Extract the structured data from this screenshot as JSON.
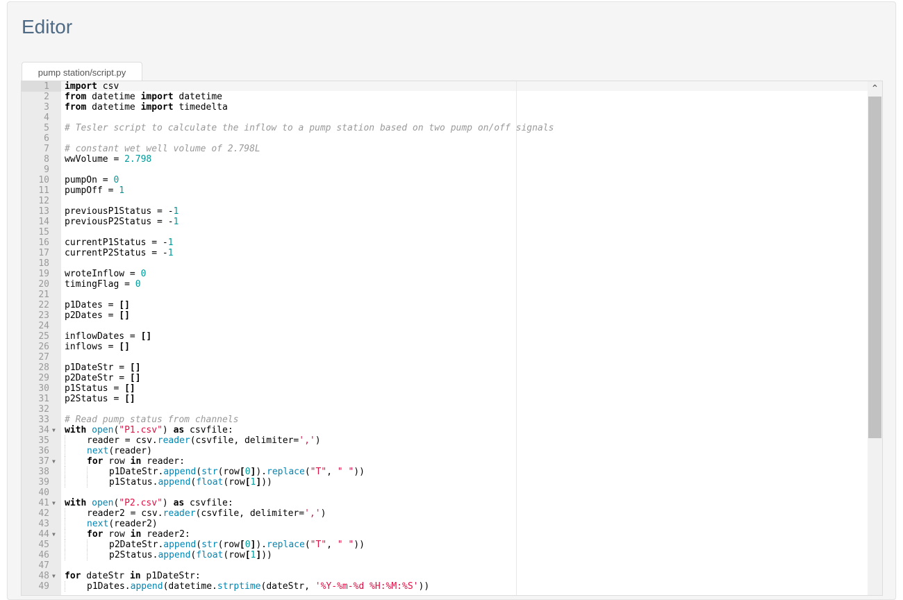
{
  "page": {
    "title": "Editor"
  },
  "tab": {
    "label": "pump station/script.py"
  },
  "scrollbar": {
    "up_icon": "chevron-up-icon"
  },
  "lines": [
    {
      "n": "1",
      "fold": false,
      "indent": 0,
      "tokens": [
        [
          "k",
          "import"
        ],
        [
          "t",
          " csv"
        ]
      ]
    },
    {
      "n": "2",
      "fold": false,
      "indent": 0,
      "tokens": [
        [
          "k",
          "from"
        ],
        [
          "t",
          " datetime "
        ],
        [
          "k",
          "import"
        ],
        [
          "t",
          " datetime"
        ]
      ]
    },
    {
      "n": "3",
      "fold": false,
      "indent": 0,
      "tokens": [
        [
          "k",
          "from"
        ],
        [
          "t",
          " datetime "
        ],
        [
          "k",
          "import"
        ],
        [
          "t",
          " timedelta"
        ]
      ]
    },
    {
      "n": "4",
      "fold": false,
      "indent": 0,
      "tokens": []
    },
    {
      "n": "5",
      "fold": false,
      "indent": 0,
      "tokens": [
        [
          "c",
          "# Tesler script to calculate the inflow to a pump station based on two pump on/off signals"
        ]
      ]
    },
    {
      "n": "6",
      "fold": false,
      "indent": 0,
      "tokens": []
    },
    {
      "n": "7",
      "fold": false,
      "indent": 0,
      "tokens": [
        [
          "c",
          "# constant wet well volume of 2.798L"
        ]
      ]
    },
    {
      "n": "8",
      "fold": false,
      "indent": 0,
      "tokens": [
        [
          "t",
          "wwVolume = "
        ],
        [
          "n",
          "2.798"
        ]
      ]
    },
    {
      "n": "9",
      "fold": false,
      "indent": 0,
      "tokens": []
    },
    {
      "n": "10",
      "fold": false,
      "indent": 0,
      "tokens": [
        [
          "t",
          "pumpOn = "
        ],
        [
          "n",
          "0"
        ]
      ]
    },
    {
      "n": "11",
      "fold": false,
      "indent": 0,
      "tokens": [
        [
          "t",
          "pumpOff = "
        ],
        [
          "n",
          "1"
        ]
      ]
    },
    {
      "n": "12",
      "fold": false,
      "indent": 0,
      "tokens": []
    },
    {
      "n": "13",
      "fold": false,
      "indent": 0,
      "tokens": [
        [
          "t",
          "previousP1Status = -"
        ],
        [
          "n",
          "1"
        ]
      ]
    },
    {
      "n": "14",
      "fold": false,
      "indent": 0,
      "tokens": [
        [
          "t",
          "previousP2Status = -"
        ],
        [
          "n",
          "1"
        ]
      ]
    },
    {
      "n": "15",
      "fold": false,
      "indent": 0,
      "tokens": []
    },
    {
      "n": "16",
      "fold": false,
      "indent": 0,
      "tokens": [
        [
          "t",
          "currentP1Status = -"
        ],
        [
          "n",
          "1"
        ]
      ]
    },
    {
      "n": "17",
      "fold": false,
      "indent": 0,
      "tokens": [
        [
          "t",
          "currentP2Status = -"
        ],
        [
          "n",
          "1"
        ]
      ]
    },
    {
      "n": "18",
      "fold": false,
      "indent": 0,
      "tokens": []
    },
    {
      "n": "19",
      "fold": false,
      "indent": 0,
      "tokens": [
        [
          "t",
          "wroteInflow = "
        ],
        [
          "n",
          "0"
        ]
      ]
    },
    {
      "n": "20",
      "fold": false,
      "indent": 0,
      "tokens": [
        [
          "t",
          "timingFlag = "
        ],
        [
          "n",
          "0"
        ]
      ]
    },
    {
      "n": "21",
      "fold": false,
      "indent": 0,
      "tokens": []
    },
    {
      "n": "22",
      "fold": false,
      "indent": 0,
      "tokens": [
        [
          "t",
          "p1Dates = "
        ],
        [
          "b",
          "[]"
        ]
      ]
    },
    {
      "n": "23",
      "fold": false,
      "indent": 0,
      "tokens": [
        [
          "t",
          "p2Dates = "
        ],
        [
          "b",
          "[]"
        ]
      ]
    },
    {
      "n": "24",
      "fold": false,
      "indent": 0,
      "tokens": []
    },
    {
      "n": "25",
      "fold": false,
      "indent": 0,
      "tokens": [
        [
          "t",
          "inflowDates = "
        ],
        [
          "b",
          "[]"
        ]
      ]
    },
    {
      "n": "26",
      "fold": false,
      "indent": 0,
      "tokens": [
        [
          "t",
          "inflows = "
        ],
        [
          "b",
          "[]"
        ]
      ]
    },
    {
      "n": "27",
      "fold": false,
      "indent": 0,
      "tokens": []
    },
    {
      "n": "28",
      "fold": false,
      "indent": 0,
      "tokens": [
        [
          "t",
          "p1DateStr = "
        ],
        [
          "b",
          "[]"
        ]
      ]
    },
    {
      "n": "29",
      "fold": false,
      "indent": 0,
      "tokens": [
        [
          "t",
          "p2DateStr = "
        ],
        [
          "b",
          "[]"
        ]
      ]
    },
    {
      "n": "30",
      "fold": false,
      "indent": 0,
      "tokens": [
        [
          "t",
          "p1Status = "
        ],
        [
          "b",
          "[]"
        ]
      ]
    },
    {
      "n": "31",
      "fold": false,
      "indent": 0,
      "tokens": [
        [
          "t",
          "p2Status = "
        ],
        [
          "b",
          "[]"
        ]
      ]
    },
    {
      "n": "32",
      "fold": false,
      "indent": 0,
      "tokens": []
    },
    {
      "n": "33",
      "fold": false,
      "indent": 0,
      "tokens": [
        [
          "c",
          "# Read pump status from channels"
        ]
      ]
    },
    {
      "n": "34",
      "fold": true,
      "indent": 0,
      "tokens": [
        [
          "k",
          "with"
        ],
        [
          "t",
          " "
        ],
        [
          "f",
          "open"
        ],
        [
          "t",
          "("
        ],
        [
          "s",
          "\"P1.csv\""
        ],
        [
          "t",
          ") "
        ],
        [
          "k",
          "as"
        ],
        [
          "t",
          " csvfile:"
        ]
      ]
    },
    {
      "n": "35",
      "fold": false,
      "indent": 1,
      "tokens": [
        [
          "t",
          "reader = csv."
        ],
        [
          "f",
          "reader"
        ],
        [
          "t",
          "(csvfile, delimiter="
        ],
        [
          "s",
          "','"
        ],
        [
          "t",
          ")"
        ]
      ]
    },
    {
      "n": "36",
      "fold": false,
      "indent": 1,
      "tokens": [
        [
          "f",
          "next"
        ],
        [
          "t",
          "(reader)"
        ]
      ]
    },
    {
      "n": "37",
      "fold": true,
      "indent": 1,
      "tokens": [
        [
          "k",
          "for"
        ],
        [
          "t",
          " row "
        ],
        [
          "k",
          "in"
        ],
        [
          "t",
          " reader:"
        ]
      ]
    },
    {
      "n": "38",
      "fold": false,
      "indent": 2,
      "tokens": [
        [
          "t",
          "p1DateStr."
        ],
        [
          "f",
          "append"
        ],
        [
          "t",
          "("
        ],
        [
          "f",
          "str"
        ],
        [
          "t",
          "(row"
        ],
        [
          "b",
          "["
        ],
        [
          "n",
          "0"
        ],
        [
          "b",
          "]"
        ],
        [
          "t",
          ")."
        ],
        [
          "f",
          "replace"
        ],
        [
          "t",
          "("
        ],
        [
          "s",
          "\"T\""
        ],
        [
          "t",
          ", "
        ],
        [
          "s",
          "\" \""
        ],
        [
          "t",
          "))"
        ]
      ]
    },
    {
      "n": "39",
      "fold": false,
      "indent": 2,
      "tokens": [
        [
          "t",
          "p1Status."
        ],
        [
          "f",
          "append"
        ],
        [
          "t",
          "("
        ],
        [
          "f",
          "float"
        ],
        [
          "t",
          "(row"
        ],
        [
          "b",
          "["
        ],
        [
          "n",
          "1"
        ],
        [
          "b",
          "]"
        ],
        [
          "t",
          "))"
        ]
      ]
    },
    {
      "n": "40",
      "fold": false,
      "indent": 0,
      "tokens": []
    },
    {
      "n": "41",
      "fold": true,
      "indent": 0,
      "tokens": [
        [
          "k",
          "with"
        ],
        [
          "t",
          " "
        ],
        [
          "f",
          "open"
        ],
        [
          "t",
          "("
        ],
        [
          "s",
          "\"P2.csv\""
        ],
        [
          "t",
          ") "
        ],
        [
          "k",
          "as"
        ],
        [
          "t",
          " csvfile:"
        ]
      ]
    },
    {
      "n": "42",
      "fold": false,
      "indent": 1,
      "tokens": [
        [
          "t",
          "reader2 = csv."
        ],
        [
          "f",
          "reader"
        ],
        [
          "t",
          "(csvfile, delimiter="
        ],
        [
          "s",
          "','"
        ],
        [
          "t",
          ")"
        ]
      ]
    },
    {
      "n": "43",
      "fold": false,
      "indent": 1,
      "tokens": [
        [
          "f",
          "next"
        ],
        [
          "t",
          "(reader2)"
        ]
      ]
    },
    {
      "n": "44",
      "fold": true,
      "indent": 1,
      "tokens": [
        [
          "k",
          "for"
        ],
        [
          "t",
          " row "
        ],
        [
          "k",
          "in"
        ],
        [
          "t",
          " reader2:"
        ]
      ]
    },
    {
      "n": "45",
      "fold": false,
      "indent": 2,
      "tokens": [
        [
          "t",
          "p2DateStr."
        ],
        [
          "f",
          "append"
        ],
        [
          "t",
          "("
        ],
        [
          "f",
          "str"
        ],
        [
          "t",
          "(row"
        ],
        [
          "b",
          "["
        ],
        [
          "n",
          "0"
        ],
        [
          "b",
          "]"
        ],
        [
          "t",
          ")."
        ],
        [
          "f",
          "replace"
        ],
        [
          "t",
          "("
        ],
        [
          "s",
          "\"T\""
        ],
        [
          "t",
          ", "
        ],
        [
          "s",
          "\" \""
        ],
        [
          "t",
          "))"
        ]
      ]
    },
    {
      "n": "46",
      "fold": false,
      "indent": 2,
      "tokens": [
        [
          "t",
          "p2Status."
        ],
        [
          "f",
          "append"
        ],
        [
          "t",
          "("
        ],
        [
          "f",
          "float"
        ],
        [
          "t",
          "(row"
        ],
        [
          "b",
          "["
        ],
        [
          "n",
          "1"
        ],
        [
          "b",
          "]"
        ],
        [
          "t",
          "))"
        ]
      ]
    },
    {
      "n": "47",
      "fold": false,
      "indent": 0,
      "tokens": []
    },
    {
      "n": "48",
      "fold": true,
      "indent": 0,
      "tokens": [
        [
          "k",
          "for"
        ],
        [
          "t",
          " dateStr "
        ],
        [
          "k",
          "in"
        ],
        [
          "t",
          " p1DateStr:"
        ]
      ]
    },
    {
      "n": "49",
      "fold": false,
      "indent": 1,
      "tokens": [
        [
          "t",
          "p1Dates."
        ],
        [
          "f",
          "append"
        ],
        [
          "t",
          "(datetime."
        ],
        [
          "f",
          "strptime"
        ],
        [
          "t",
          "(dateStr, "
        ],
        [
          "s",
          "'%Y-%m-%d %H:%M:%S'"
        ],
        [
          "t",
          "))"
        ]
      ]
    }
  ]
}
